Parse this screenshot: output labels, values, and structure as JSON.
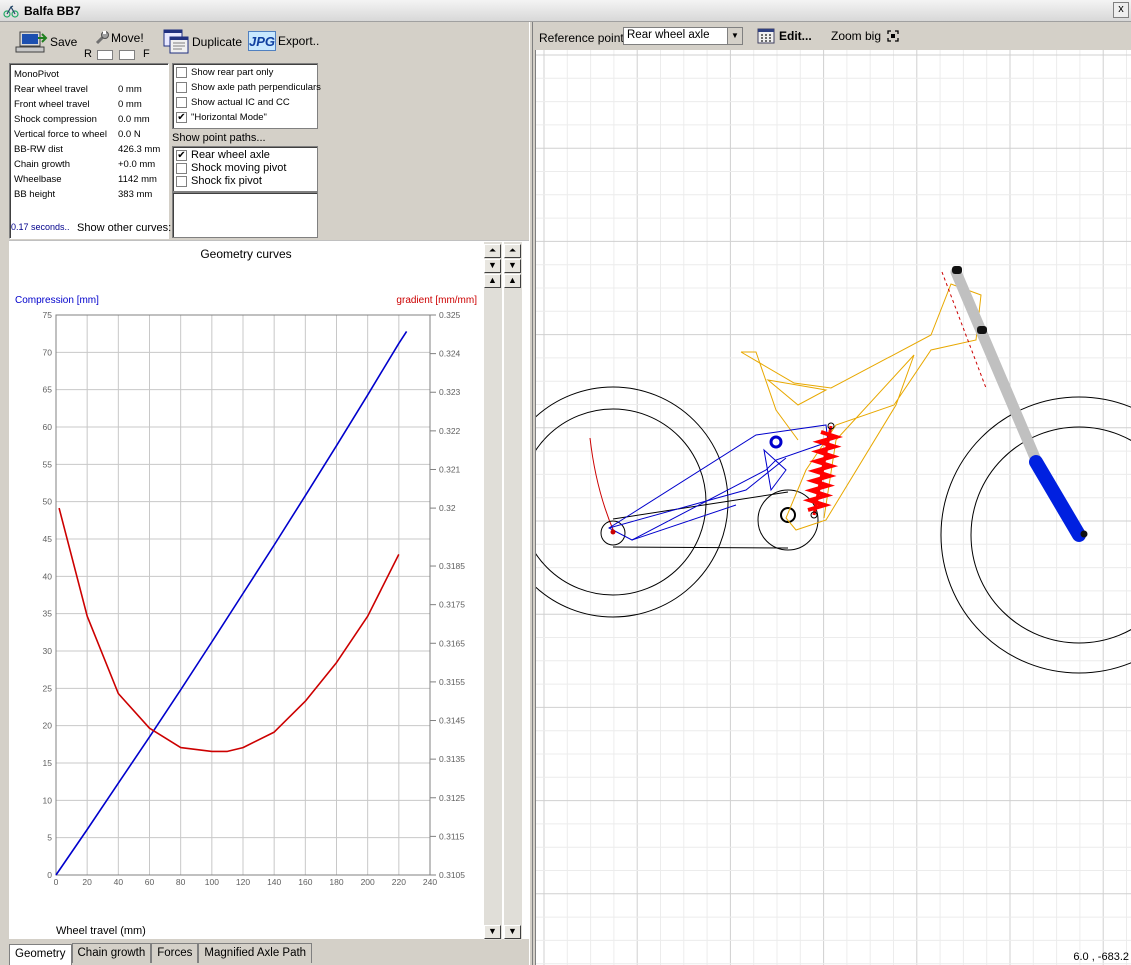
{
  "window": {
    "title": "Balfa BB7",
    "close_glyph": "x"
  },
  "toolbar": {
    "save_label": "Save",
    "move_label": "Move!",
    "move_r_label": "R",
    "move_f_label": "F",
    "duplicate_label": "Duplicate",
    "export_label": "Export..",
    "export_icon_text": "JPG"
  },
  "info": {
    "title": "MonoPivot",
    "rows": [
      {
        "label": "Rear wheel travel",
        "value": "0 mm"
      },
      {
        "label": "Front wheel travel",
        "value": "0 mm"
      },
      {
        "label": "Shock compression",
        "value": "0.0 mm"
      },
      {
        "label": "Vertical force to wheel",
        "value": "0.0 N"
      },
      {
        "label": "BB-RW dist",
        "value": "426.3 mm"
      },
      {
        "label": "Chain growth",
        "value": "+0.0 mm"
      },
      {
        "label": "Wheelbase",
        "value": "1142 mm"
      },
      {
        "label": "BB height",
        "value": "383 mm"
      }
    ],
    "time": "0.17 seconds..",
    "other_curves_label": "Show other curves:"
  },
  "options": [
    {
      "label": "Show rear part only",
      "checked": false
    },
    {
      "label": "Show axle path perpendiculars",
      "checked": false
    },
    {
      "label": "Show actual IC and CC",
      "checked": false
    },
    {
      "label": "\"Horizontal Mode\"",
      "checked": true
    }
  ],
  "point_paths": {
    "label": "Show point paths...",
    "items": [
      {
        "label": "Rear wheel axle",
        "checked": true
      },
      {
        "label": "Shock moving pivot",
        "checked": false
      },
      {
        "label": "Shock fix pivot",
        "checked": false
      }
    ]
  },
  "check_glyph": "✔",
  "scroll_glyphs": {
    "top": "⏶",
    "up": "▲",
    "down": "▼"
  },
  "tabs": [
    {
      "label": "Geometry",
      "active": true
    },
    {
      "label": "Chain growth",
      "active": false
    },
    {
      "label": "Forces",
      "active": false
    },
    {
      "label": "Magnified Axle Path",
      "active": false
    }
  ],
  "right_toolbar": {
    "reference_label": "Reference point:",
    "reference_value": "Rear wheel axle",
    "edit_label": "Edit...",
    "zoom_label": "Zoom big"
  },
  "coords_readout": "6.0 , -683.2",
  "colors": {
    "blue": "#0000cc",
    "red": "#cc0000",
    "grid": "#c8c8c8",
    "frame": "#e8a800",
    "fork": "#c0c0c0",
    "shock": "#ff0000"
  },
  "chart_data": {
    "type": "line",
    "title": "Geometry curves",
    "xlabel": "Wheel travel (mm)",
    "ylabel": "Compression [mm]",
    "y2label": "gradient [mm/mm]",
    "xlim": [
      0,
      240
    ],
    "ylim": [
      0,
      75
    ],
    "y2lim": [
      0.3105,
      0.325
    ],
    "x_ticks": [
      0,
      20,
      40,
      60,
      80,
      100,
      120,
      140,
      160,
      180,
      200,
      220,
      240
    ],
    "y_ticks": [
      0,
      5,
      10,
      15,
      20,
      25,
      30,
      35,
      40,
      45,
      50,
      55,
      60,
      65,
      70,
      75
    ],
    "y2_ticks": [
      "0.3105",
      "0.3115",
      "0.3125",
      "0.3135",
      "0.3145",
      "0.3155",
      "0.3165",
      "0.3175",
      "0.3185",
      "0.32",
      "0.321",
      "0.322",
      "0.323",
      "0.324",
      "0.325"
    ],
    "grid": true,
    "series": [
      {
        "name": "Compression [mm]",
        "axis": "left",
        "color": "#0000cc",
        "x": [
          0,
          20,
          40,
          60,
          80,
          100,
          120,
          140,
          160,
          180,
          200,
          220,
          225
        ],
        "y": [
          0,
          6.1,
          12.3,
          18.5,
          24.8,
          31.2,
          37.7,
          44.2,
          50.8,
          57.5,
          64.3,
          71.2,
          72.8
        ]
      },
      {
        "name": "gradient [mm/mm]",
        "axis": "right",
        "color": "#cc0000",
        "x": [
          2,
          20,
          40,
          60,
          80,
          100,
          110,
          120,
          140,
          160,
          180,
          200,
          220
        ],
        "y": [
          0.32,
          0.3172,
          0.3152,
          0.3143,
          0.3138,
          0.3137,
          0.3137,
          0.3138,
          0.3142,
          0.315,
          0.316,
          0.3172,
          0.3188
        ]
      }
    ]
  }
}
